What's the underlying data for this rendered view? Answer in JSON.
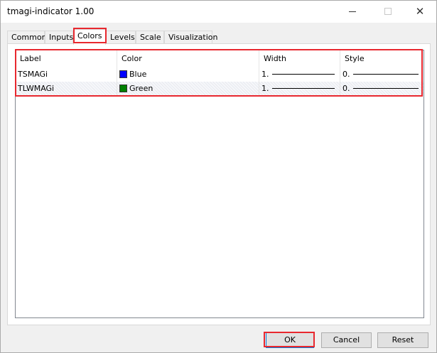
{
  "window": {
    "title": "tmagi-indicator 1.00"
  },
  "tabs": [
    {
      "label": "Common"
    },
    {
      "label": "Inputs"
    },
    {
      "label": "Colors"
    },
    {
      "label": "Levels"
    },
    {
      "label": "Scale"
    },
    {
      "label": "Visualization"
    }
  ],
  "active_tab": "Colors",
  "list": {
    "columns": [
      "Label",
      "Color",
      "Width",
      "Style"
    ],
    "rows": [
      {
        "label": "TSMAGi",
        "color_name": "Blue",
        "color_hex": "#0000ff",
        "width": "1.",
        "style": "0."
      },
      {
        "label": "TLWMAGi",
        "color_name": "Green",
        "color_hex": "#008000",
        "width": "1.",
        "style": "0."
      }
    ]
  },
  "buttons": {
    "ok": "OK",
    "cancel": "Cancel",
    "reset": "Reset"
  },
  "colors": {
    "highlight": "#e8282f",
    "accent": "#0078d7"
  }
}
